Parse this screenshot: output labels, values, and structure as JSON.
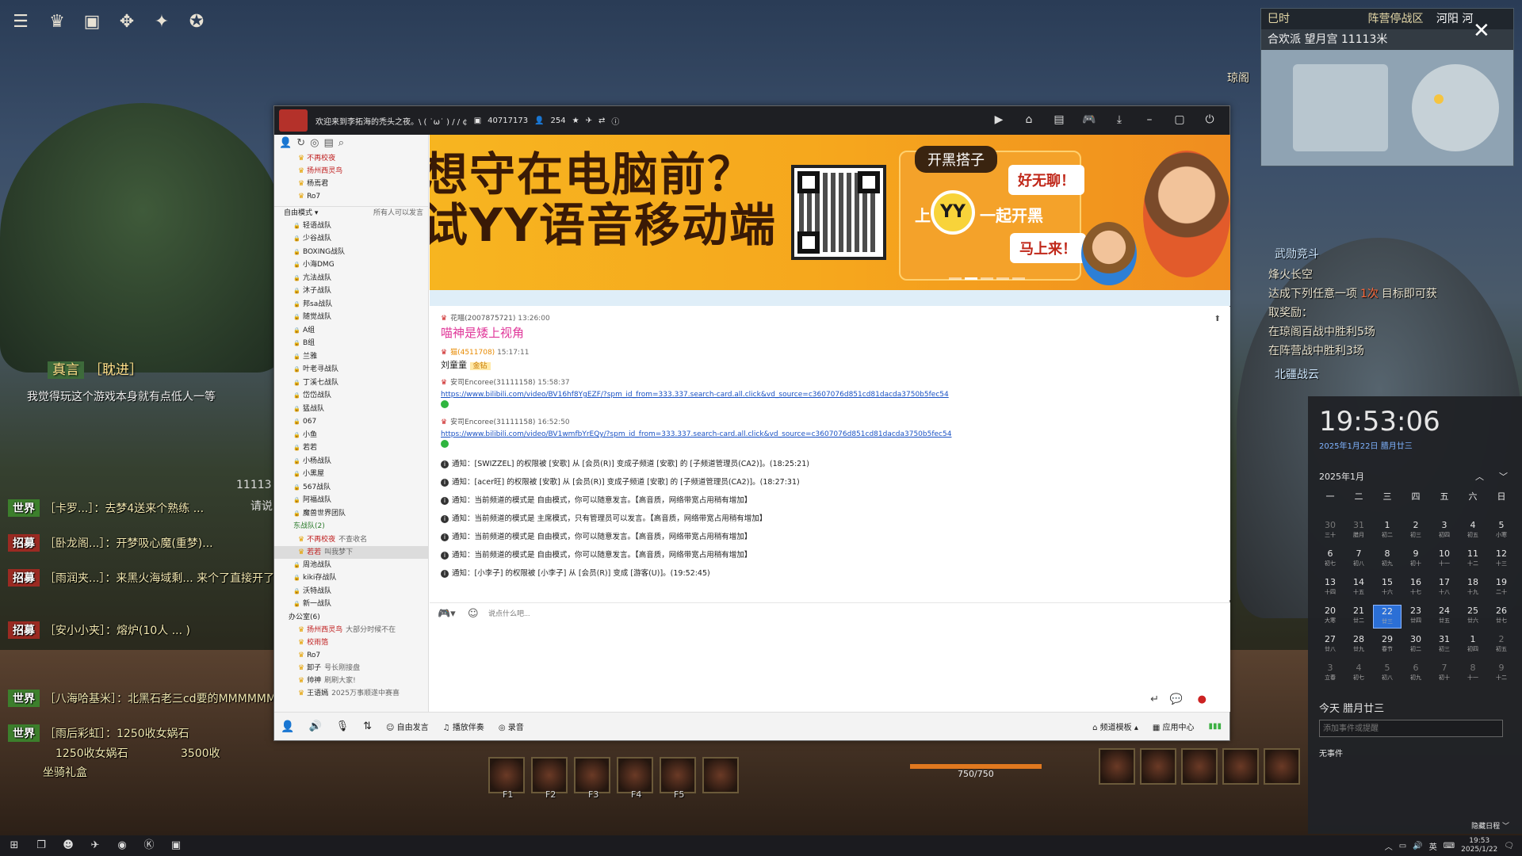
{
  "game": {
    "top_icons": [
      "menu-icon",
      "character-icon",
      "bag-icon",
      "skill-icon",
      "martial-icon",
      "mount-icon"
    ],
    "speech": {
      "tag": "真言",
      "name": "［耽进］",
      "text": "我觉得玩这个游戏本身就有点低人一等"
    },
    "chat_lines": [
      {
        "tag": "世界",
        "text": "［卡罗...］：去梦4送来个熟练 ..."
      },
      {
        "tag": "招募",
        "text": "［卧龙阁...］：开梦吸心魔(重梦)..."
      },
      {
        "tag": "招募",
        "text": "［雨润夹...］：来黑火海域剩... 来个了直接开了"
      },
      {
        "tag": "招募",
        "text": "［安小小夹］：熔炉(10人 ... )"
      },
      {
        "tag": "世界",
        "text": "［八海哈基米］：北黑石老三cd要的MMMMMMMMMMMMMM"
      },
      {
        "tag": "世界",
        "text": "［雨后彩虹］：1250收女娲石"
      }
    ],
    "chat_sub1": "1250收女娲石",
    "chat_sub2": "3500收",
    "chat_sub3": "坐骑礼盒",
    "side_text": "11113",
    "side_text2": "请说",
    "hp_text": "750/750",
    "skill_labels": [
      "F1",
      "F2",
      "F3",
      "F4",
      "F5"
    ],
    "minimap": {
      "header": "巳时",
      "region": "阵营停战区",
      "place": "河阳 河",
      "subheader": "合欢派  望月宫  11113米",
      "label_right": "琼阁"
    },
    "quest": {
      "title1": "武勋竞斗",
      "line1": "烽火长空",
      "line2": "达成下列任意一项",
      "line2b": "1次",
      "line2c": "目标即可获",
      "line3": "取奖励：",
      "line4": "在琼阁百战中胜利5场",
      "line5": "在阵营战中胜利3场",
      "title2": "北疆战云"
    }
  },
  "yy": {
    "title": "欢迎来到李拓海的禿头之夜。\\ ( ˙ω˙ ) / / ¢",
    "channel_id": "40717173",
    "online": "254",
    "sidebar_mode": "自由模式",
    "sidebar_mode_right": "所有人可以发言",
    "top_members": [
      "不再校夜",
      "扬州西灵鸟",
      "杨焉君",
      "Ro7"
    ],
    "groups": [
      "轻语战队",
      "少谷战队",
      "BOXING战队",
      "小海DMG",
      "亢法战队",
      "沐子战队",
      "邦sa战队",
      "随觉战队",
      "A组",
      "B组",
      "兰雅",
      "叶老寻战队",
      "丁溪七战队",
      "岱岱战队",
      "猛战队",
      "067",
      "小鱼",
      "若若",
      "小杨战队",
      "小黑屋",
      "567战队",
      "阿福战队",
      "魔兽世界团队"
    ],
    "group_open": "东战队(2)",
    "open_members": [
      {
        "name": "不再校夜",
        "note": "不查收名"
      },
      {
        "name": "若若",
        "note": "叫我梦下"
      }
    ],
    "groups2": [
      "周池战队",
      "kiki存战队",
      "沃特战队",
      "新一战队"
    ],
    "office": "办公室(6)",
    "office_members": [
      {
        "name": "扬州西灵鸟",
        "note": "大部分时候不在"
      },
      {
        "name": "校雨箔",
        "note": ""
      },
      {
        "name": "Ro7",
        "note": ""
      },
      {
        "name": "卸子",
        "note": "号长刚接盘"
      },
      {
        "name": "帅神",
        "note": "刷刷大家!"
      },
      {
        "name": "王语嫣",
        "note": "2025万事顺遂中赛喜"
      }
    ],
    "banner": {
      "text1": "想守在电脑前？",
      "text2": "试YY语音移动端",
      "tag": "开黑搭子",
      "bubble1": "好无聊！",
      "line_prefix": "上",
      "yy": "YY",
      "line_suffix": "一起开黑",
      "bubble2": "马上来！"
    },
    "messages": [
      {
        "user": "花喵(2007875721)",
        "time": "13:26:00",
        "text": "喵神是矮上视角",
        "big": true
      },
      {
        "user": "猫(4511708)",
        "time": "15:17:11",
        "text": "刘童童",
        "badge": "金钻"
      },
      {
        "user": "安司Encoree(31111158)",
        "time": "15:58:37",
        "link": "https://www.bilibili.com/video/BV16hf8YgEZF/?spm_id_from=333.337.search-card.all.click&vd_source=c3607076d851cd81dacda3750b5fec54"
      },
      {
        "user": "安司Encoree(31111158)",
        "time": "16:52:50",
        "link": "https://www.bilibili.com/video/BV1wmfbYrEQy/?spm_id_from=333.337.search-card.all.click&vd_source=c3607076d851cd81dacda3750b5fec54"
      }
    ],
    "notices": [
      "通知：[SWIZZEL] 的权限被 [安歌] 从 [会员(R)] 变成子频道 [安歌] 的 [子频道管理员(CA2)]。(18:25:21)",
      "通知：[acer旺] 的权限被 [安歌] 从 [会员(R)] 变成子频道 [安歌] 的 [子频道管理员(CA2)]。(18:27:31)",
      "通知：当前频道的模式是 自由模式，你可以随意发言。【高音质，网络带宽占用稍有增加】",
      "通知：当前频道的模式是 主席模式，只有管理员可以发言。【高音质，网络带宽占用稍有增加】",
      "通知：当前频道的模式是 自由模式，你可以随意发言。【高音质，网络带宽占用稍有增加】",
      "通知：当前频道的模式是 自由模式，你可以随意发言。【高音质，网络带宽占用稍有增加】",
      "通知：[小李子] 的权限被 [小李子] 从 [会员(R)] 变成 [游客(U)]。(19:52:45)"
    ],
    "input_placeholder": "说点什么吧...",
    "bottom": {
      "free": "自由发言",
      "accomp": "播放伴奏",
      "record": "录音",
      "template": "频道模板",
      "apps": "应用中心"
    }
  },
  "calendar": {
    "time": "19:53:06",
    "date": "2025年1月22日 腊月廿三",
    "month": "2025年1月",
    "weekdays": [
      "一",
      "二",
      "三",
      "四",
      "五",
      "六",
      "日"
    ],
    "days": [
      [
        "30",
        "三十"
      ],
      [
        "31",
        "腊月"
      ],
      [
        "1",
        "初二"
      ],
      [
        "2",
        "初三"
      ],
      [
        "3",
        "初四"
      ],
      [
        "4",
        "初五"
      ],
      [
        "5",
        "小寒"
      ],
      [
        "6",
        "初七"
      ],
      [
        "7",
        "初八"
      ],
      [
        "8",
        "初九"
      ],
      [
        "9",
        "初十"
      ],
      [
        "10",
        "十一"
      ],
      [
        "11",
        "十二"
      ],
      [
        "12",
        "十三"
      ],
      [
        "13",
        "十四"
      ],
      [
        "14",
        "十五"
      ],
      [
        "15",
        "十六"
      ],
      [
        "16",
        "十七"
      ],
      [
        "17",
        "十八"
      ],
      [
        "18",
        "十九"
      ],
      [
        "19",
        "二十"
      ],
      [
        "20",
        "大寒"
      ],
      [
        "21",
        "廿二"
      ],
      [
        "22",
        "廿三"
      ],
      [
        "23",
        "廿四"
      ],
      [
        "24",
        "廿五"
      ],
      [
        "25",
        "廿六"
      ],
      [
        "26",
        "廿七"
      ],
      [
        "27",
        "廿八"
      ],
      [
        "28",
        "廿九"
      ],
      [
        "29",
        "春节"
      ],
      [
        "30",
        "初二"
      ],
      [
        "31",
        "初三"
      ],
      [
        "1",
        "初四"
      ],
      [
        "2",
        "初五"
      ],
      [
        "3",
        "立春"
      ],
      [
        "4",
        "初七"
      ],
      [
        "5",
        "初八"
      ],
      [
        "6",
        "初九"
      ],
      [
        "7",
        "初十"
      ],
      [
        "8",
        "十一"
      ],
      [
        "9",
        "十二"
      ]
    ],
    "today_label": "今天 腊月廿三",
    "add_placeholder": "添加事件或提醒",
    "no_events": "无事件",
    "hide": "隐藏日程"
  },
  "taskbar": {
    "time": "19:53",
    "date": "2025/1/22",
    "lang": "英"
  }
}
